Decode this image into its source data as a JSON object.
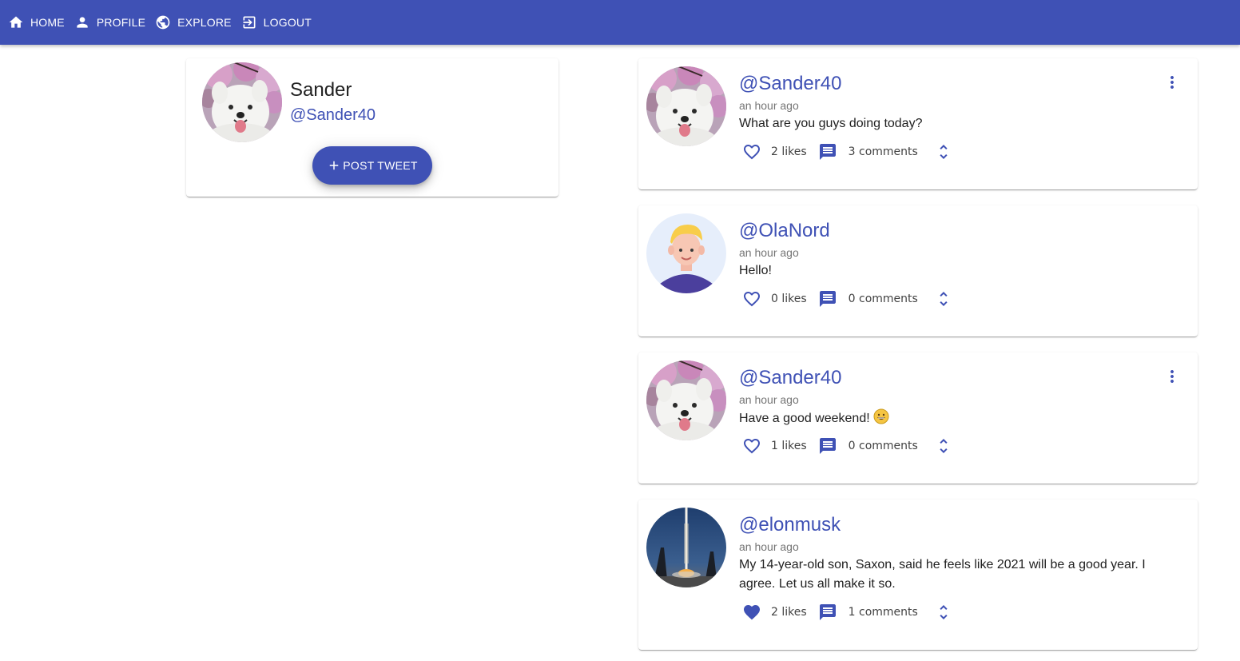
{
  "nav": {
    "home": "HOME",
    "profile": "PROFILE",
    "explore": "EXPLORE",
    "logout": "LOGOUT"
  },
  "profile": {
    "name": "Sander",
    "handle": "@Sander40",
    "post_button": "POST TWEET"
  },
  "tweets": [
    {
      "handle": "@Sander40",
      "time": "an hour ago",
      "text": "What are you guys doing today?",
      "likes": "2 likes",
      "comments": "3 comments",
      "liked": false,
      "has_menu": true,
      "avatar": "samoyed-dog"
    },
    {
      "handle": "@OlaNord",
      "time": "an hour ago",
      "text": "Hello!",
      "likes": "0 likes",
      "comments": "0 comments",
      "liked": false,
      "has_menu": false,
      "avatar": "cartoon-person"
    },
    {
      "handle": "@Sander40",
      "time": "an hour ago",
      "text": "Have a good weekend!",
      "emoji": "😄",
      "likes": "1 likes",
      "comments": "0 comments",
      "liked": false,
      "has_menu": true,
      "avatar": "samoyed-dog"
    },
    {
      "handle": "@elonmusk",
      "time": "an hour ago",
      "text": "My 14-year-old son, Saxon, said he feels like 2021 will be a good year. I agree. Let us all make it so.",
      "likes": "2 likes",
      "comments": "1 comments",
      "liked": true,
      "has_menu": false,
      "avatar": "rocket-launch"
    }
  ],
  "colors": {
    "primary": "#3f51b5",
    "text": "#212121",
    "secondary_text": "#757575"
  }
}
